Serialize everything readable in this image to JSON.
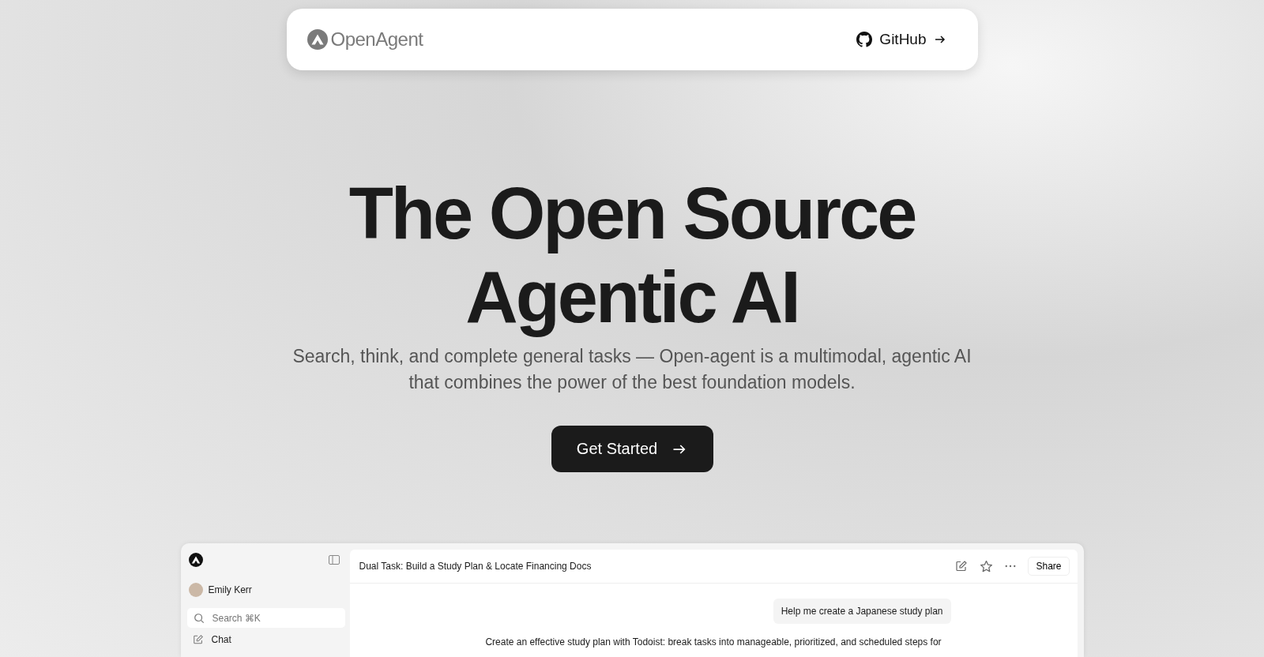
{
  "nav": {
    "brand": "OpenAgent",
    "link": "GitHub"
  },
  "hero": {
    "title_lines": [
      "The Open Source",
      "Agentic AI"
    ],
    "subtitle": "Search, think, and complete general tasks — Open-agent is a multimodal, agentic AI that combines the power of the best foundation models.",
    "cta": "Get Started"
  },
  "preview": {
    "user": "Emily Kerr",
    "search": {
      "placeholder": "Search ⌘K"
    },
    "sidebar_items": [
      {
        "label": "Chat"
      }
    ],
    "chat_title": "Dual Task: Build a Study Plan & Locate Financing Docs",
    "share": "Share",
    "user_message": "Help me create a Japanese study plan",
    "reply": "Create an effective study plan with Todoist: break tasks into manageable, prioritized, and scheduled steps for"
  }
}
